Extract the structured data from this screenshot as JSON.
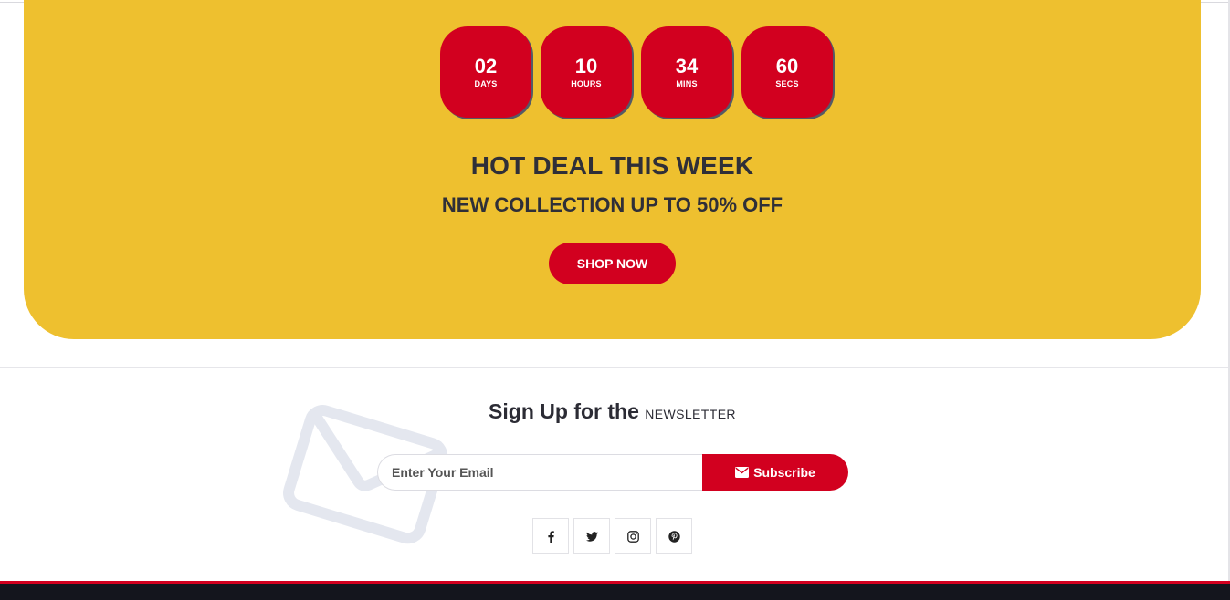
{
  "countdown": [
    {
      "value": "02",
      "unit": "DAYS"
    },
    {
      "value": "10",
      "unit": "HOURS"
    },
    {
      "value": "34",
      "unit": "MINS"
    },
    {
      "value": "60",
      "unit": "SECS"
    }
  ],
  "deal": {
    "title": "HOT DEAL THIS WEEK",
    "subtitle": "NEW COLLECTION UP TO 50% OFF",
    "button_label": "SHOP NOW"
  },
  "newsletter": {
    "title_main": "Sign Up for the",
    "title_small": "NEWSLETTER",
    "email_placeholder": "Enter Your Email",
    "subscribe_label": "Subscribe"
  },
  "social_icons": [
    "facebook-icon",
    "twitter-icon",
    "instagram-icon",
    "pinterest-icon"
  ],
  "colors": {
    "banner": "#eec02f",
    "accent": "#d2001f",
    "footer": "#14151d",
    "text": "#2b2b34"
  }
}
